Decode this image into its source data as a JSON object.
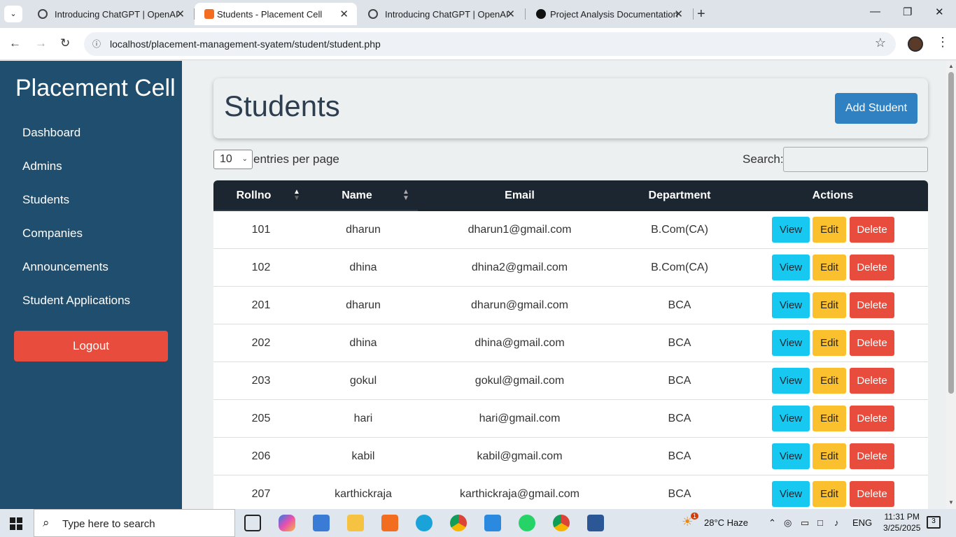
{
  "browser": {
    "tabs": [
      {
        "title": "Introducing ChatGPT | OpenAI",
        "active": false
      },
      {
        "title": "Students - Placement Cell",
        "active": true
      },
      {
        "title": "Introducing ChatGPT | OpenAI",
        "active": false
      },
      {
        "title": "Project Analysis Documentation",
        "active": false
      }
    ],
    "url": "localhost/placement-management-syatem/student/student.php"
  },
  "sidebar": {
    "brand": "Placement Cell",
    "items": [
      "Dashboard",
      "Admins",
      "Students",
      "Companies",
      "Announcements",
      "Student Applications"
    ],
    "logout": "Logout"
  },
  "main": {
    "title": "Students",
    "add_button": "Add Student",
    "entries_value": "10",
    "entries_label": "entries per page",
    "search_label": "Search:",
    "columns": [
      "Rollno",
      "Name",
      "Email",
      "Department",
      "Actions"
    ],
    "rows": [
      {
        "rollno": "101",
        "name": "dharun",
        "email": "dharun1@gmail.com",
        "department": "B.Com(CA)"
      },
      {
        "rollno": "102",
        "name": "dhina",
        "email": "dhina2@gmail.com",
        "department": "B.Com(CA)"
      },
      {
        "rollno": "201",
        "name": "dharun",
        "email": "dharun@gmail.com",
        "department": "BCA"
      },
      {
        "rollno": "202",
        "name": "dhina",
        "email": "dhina@gmail.com",
        "department": "BCA"
      },
      {
        "rollno": "203",
        "name": "gokul",
        "email": "gokul@gmail.com",
        "department": "BCA"
      },
      {
        "rollno": "205",
        "name": "hari",
        "email": "hari@gmail.com",
        "department": "BCA"
      },
      {
        "rollno": "206",
        "name": "kabil",
        "email": "kabil@gmail.com",
        "department": "BCA"
      },
      {
        "rollno": "207",
        "name": "karthickraja",
        "email": "karthickraja@gmail.com",
        "department": "BCA"
      }
    ],
    "actions": {
      "view": "View",
      "edit": "Edit",
      "delete": "Delete"
    }
  },
  "taskbar": {
    "search_placeholder": "Type here to search",
    "weather": "28°C  Haze",
    "weather_badge": "1",
    "language": "ENG",
    "time": "11:31 PM",
    "date": "3/25/2025",
    "notifications": "3"
  },
  "colors": {
    "sidebar": "#1f4e6e",
    "logout": "#e74c3c",
    "add_button": "#2f81c2",
    "table_header": "#1b2631",
    "view": "#17c9f0",
    "edit": "#fbc02d",
    "delete": "#e74c3c"
  }
}
